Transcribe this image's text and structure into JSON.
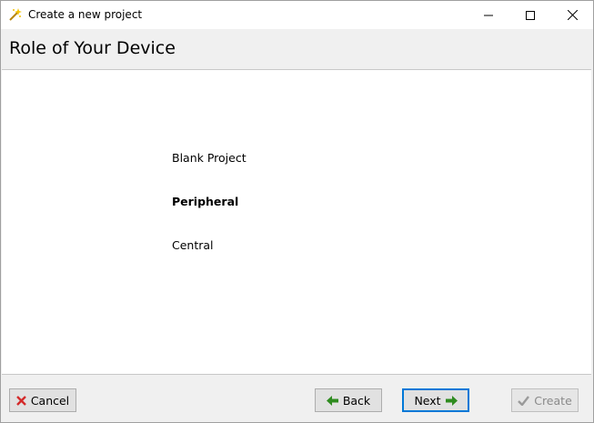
{
  "window": {
    "title": "Create a new project",
    "icon": "wand-icon",
    "controls": [
      "minimize-icon",
      "maximize-icon",
      "close-icon"
    ]
  },
  "header": {
    "title": "Role of Your Device"
  },
  "options": [
    {
      "label": "Blank Project",
      "selected": false
    },
    {
      "label": "Peripheral",
      "selected": true
    },
    {
      "label": "Central",
      "selected": false
    }
  ],
  "footer": {
    "cancel_label": "Cancel",
    "cancel_icon": "x-icon",
    "back_label": "Back",
    "back_icon": "arrow-left-icon",
    "next_label": "Next",
    "next_icon": "arrow-right-icon",
    "create_label": "Create",
    "create_icon": "checkmark-icon",
    "create_enabled": false
  },
  "colors": {
    "cancel_icon": "#d42a2a",
    "arrow_icon": "#2e8b1f",
    "focus_border": "#0078d7",
    "disabled_text": "#8a8a8a"
  }
}
